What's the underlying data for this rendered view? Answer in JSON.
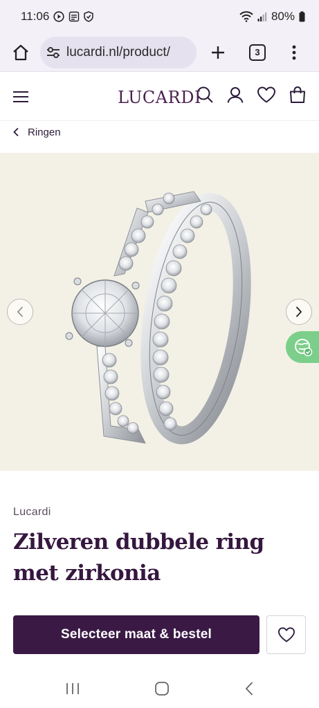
{
  "status_bar": {
    "time": "11:06",
    "battery": "80%",
    "icons": [
      "play-icon",
      "news-icon",
      "shield-icon",
      "wifi-icon",
      "signal-icon",
      "battery-icon"
    ]
  },
  "browser": {
    "url": "lucardi.nl/product/",
    "tab_count": "3"
  },
  "site": {
    "brand": "LUCARDI",
    "header_icons": [
      "menu-icon",
      "search-icon",
      "account-icon",
      "wishlist-icon",
      "cart-icon"
    ]
  },
  "breadcrumb": {
    "label": "Ringen"
  },
  "gallery": {
    "background": "#f3f1e6"
  },
  "product": {
    "brand": "Lucardi",
    "title": "Zilveren dubbele ring met zirkonia",
    "cta_label": "Selecteer maat & bestel"
  },
  "colors": {
    "primary": "#3a1a45",
    "brand": "#4a1f4f",
    "accent_green": "#7ccf8a"
  }
}
